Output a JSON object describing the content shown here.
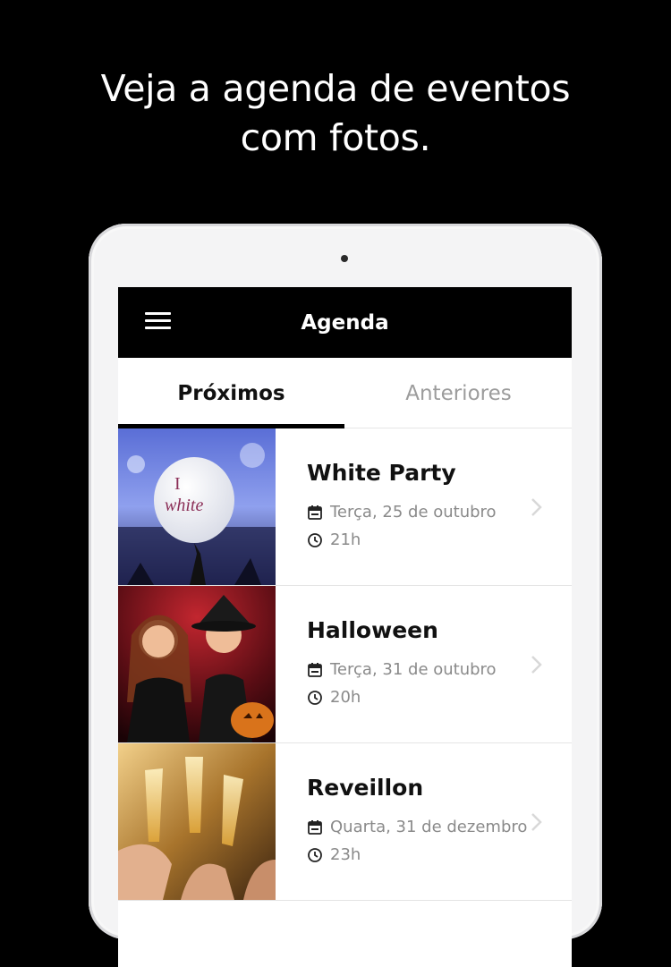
{
  "headline": {
    "line1": "Veja a agenda de eventos",
    "line2": "com fotos."
  },
  "appbar": {
    "title": "Agenda",
    "menu_icon": "hamburger-menu-icon"
  },
  "tabs": [
    {
      "label": "Próximos",
      "active": true
    },
    {
      "label": "Anteriores",
      "active": false
    }
  ],
  "events": [
    {
      "title": "White Party",
      "date": "Terça, 25 de outubro",
      "time": "21h",
      "balloon_text_1": "I",
      "balloon_text_2": "white"
    },
    {
      "title": "Halloween",
      "date": "Terça, 31 de outubro",
      "time": "20h"
    },
    {
      "title": "Reveillon",
      "date": "Quarta, 31 de dezembro",
      "time": "23h"
    }
  ],
  "colors": {
    "background": "#000000",
    "appbar": "#000000",
    "tab_indicator": "#000000",
    "meta_text": "#8a8a8a",
    "balloon_text": "#8b2e57"
  }
}
